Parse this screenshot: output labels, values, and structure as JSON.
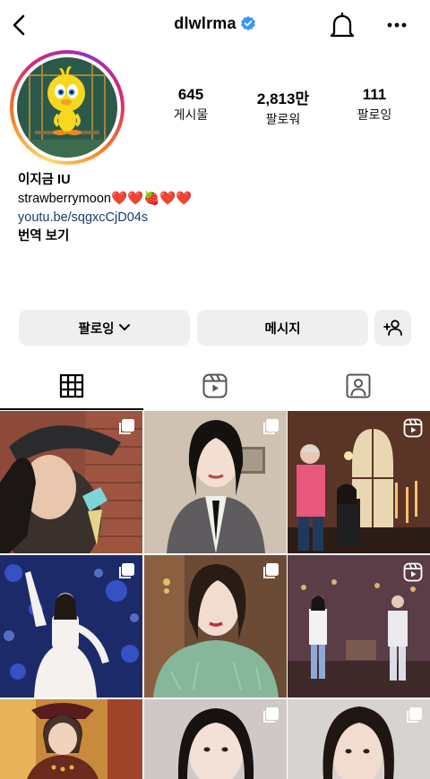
{
  "header": {
    "username": "dlwlrma",
    "icons": [
      "back-arrow-icon",
      "verified-badge-icon",
      "bell-icon",
      "more-options-icon"
    ]
  },
  "profile": {
    "avatar": "tweety-bird-avatar",
    "stats": [
      {
        "value": "645",
        "label": "게시물"
      },
      {
        "value": "2,813만",
        "label": "팔로워"
      },
      {
        "value": "111",
        "label": "팔로잉"
      }
    ],
    "name": "이지금 IU",
    "bio_text": "strawberrymoon",
    "bio_emoji": "❤️❤️🍓❤️❤️",
    "link": "youtu.be/sqgxcCjD04s",
    "translate": "번역 보기"
  },
  "actions": {
    "following_label": "팔로잉",
    "message_label": "메시지",
    "add_user_icon": "add-user-icon"
  },
  "tabs": [
    {
      "name": "grid-tab",
      "icon": "grid-icon",
      "active": true
    },
    {
      "name": "reels-tab",
      "icon": "reels-icon",
      "active": false
    },
    {
      "name": "tagged-tab",
      "icon": "tagged-person-icon",
      "active": false
    }
  ],
  "posts": [
    {
      "badge": "multi-photo-icon"
    },
    {
      "badge": "multi-photo-icon"
    },
    {
      "badge": "reels-icon"
    },
    {
      "badge": "multi-photo-icon"
    },
    {
      "badge": "multi-photo-icon"
    },
    {
      "badge": "reels-icon"
    },
    {
      "badge": ""
    },
    {
      "badge": "multi-photo-icon"
    },
    {
      "badge": "multi-photo-icon"
    }
  ],
  "colors": {
    "link": "#1a3c6e",
    "button_bg": "#efefef",
    "verified": "#3897f0"
  }
}
